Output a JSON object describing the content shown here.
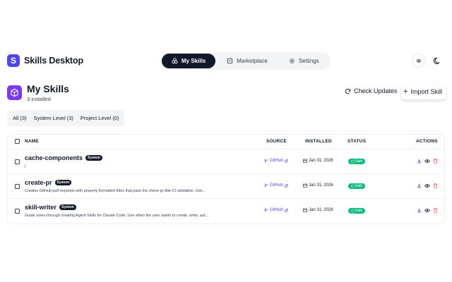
{
  "app": {
    "name": "Skills Desktop",
    "logo_letter": "S"
  },
  "nav": {
    "tabs": [
      {
        "label": "My Skills",
        "icon": "layers-icon",
        "active": true
      },
      {
        "label": "Marketplace",
        "icon": "store-icon",
        "active": false
      },
      {
        "label": "Settings",
        "icon": "gear-icon",
        "active": false
      }
    ]
  },
  "header_controls": {
    "language": "中",
    "theme_icon": "moon-icon"
  },
  "page": {
    "title": "My Skills",
    "subtitle": "3 installed",
    "icon": "box-icon",
    "check_updates_label": "Check Updates",
    "import_label": "Import Skill"
  },
  "filters": [
    {
      "label": "All (3)",
      "active": true
    },
    {
      "label": "System Level (3)",
      "active": false
    },
    {
      "label": "Project Level (0)",
      "active": false
    }
  ],
  "table": {
    "headers": {
      "name": "NAME",
      "source": "SOURCE",
      "installed": "INSTALLED",
      "status": "STATUS",
      "actions": "ACTIONS"
    },
    "rows": [
      {
        "name": "cache-components",
        "badge": "System",
        "description": "|",
        "source": "GitHub",
        "installed": "Jan 31, 2026",
        "status": "Safe"
      },
      {
        "name": "create-pr",
        "badge": "System",
        "description": "Creates GitHub pull requests with properly formatted titles that pass the check-pr-title CI validation. Use...",
        "source": "GitHub",
        "installed": "Jan 31, 2026",
        "status": "Safe"
      },
      {
        "name": "skill-writer",
        "badge": "System",
        "description": "Guide users through creating Agent Skills for Claude Code. Use when the user wants to create, write, aut...",
        "source": "GitHub",
        "installed": "Jan 31, 2026",
        "status": "Safe"
      }
    ]
  },
  "colors": {
    "accent": "#4f46e5",
    "page_icon": "#7c3aed",
    "safe": "#10b981",
    "danger": "#ef4444",
    "dark": "#111827"
  }
}
